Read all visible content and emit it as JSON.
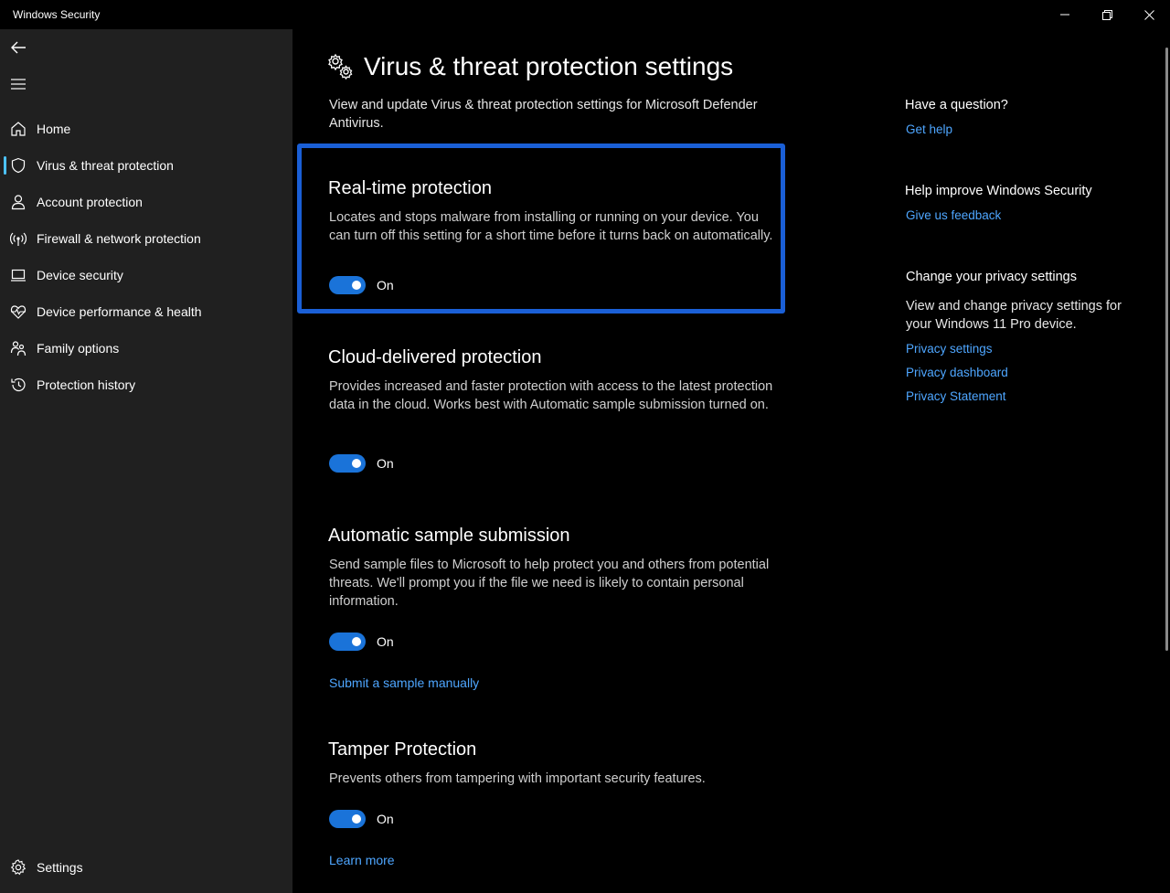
{
  "window": {
    "title": "Windows Security"
  },
  "sidebar": {
    "items": [
      {
        "label": "Home",
        "icon": "home-icon"
      },
      {
        "label": "Virus & threat protection",
        "icon": "shield-icon",
        "active": true
      },
      {
        "label": "Account protection",
        "icon": "person-icon"
      },
      {
        "label": "Firewall & network protection",
        "icon": "wifi-broadcast-icon"
      },
      {
        "label": "Device security",
        "icon": "laptop-icon"
      },
      {
        "label": "Device performance & health",
        "icon": "heart-pulse-icon"
      },
      {
        "label": "Family options",
        "icon": "family-icon"
      },
      {
        "label": "Protection history",
        "icon": "history-icon"
      }
    ],
    "settings_label": "Settings"
  },
  "main": {
    "title": "Virus & threat protection settings",
    "description": "View and update Virus & threat protection settings for Microsoft Defender Antivirus.",
    "sections": [
      {
        "title": "Real-time protection",
        "description": "Locates and stops malware from installing or running on your device. You can turn off this setting for a short time before it turns back on automatically.",
        "toggle_state": "On"
      },
      {
        "title": "Cloud-delivered protection",
        "description": "Provides increased and faster protection with access to the latest protection data in the cloud. Works best with Automatic sample submission turned on.",
        "toggle_state": "On"
      },
      {
        "title": "Automatic sample submission",
        "description": "Send sample files to Microsoft to help protect you and others from potential threats. We'll prompt you if the file we need is likely to contain personal information.",
        "toggle_state": "On",
        "link": "Submit a sample manually"
      },
      {
        "title": "Tamper Protection",
        "description": "Prevents others from tampering with important security features.",
        "toggle_state": "On",
        "link": "Learn more"
      }
    ]
  },
  "aside": {
    "question_heading": "Have a question?",
    "get_help": "Get help",
    "improve_heading": "Help improve Windows Security",
    "feedback": "Give us feedback",
    "privacy_heading": "Change your privacy settings",
    "privacy_text": "View and change privacy settings for your Windows 11 Pro device.",
    "privacy_settings": "Privacy settings",
    "privacy_dashboard": "Privacy dashboard",
    "privacy_statement": "Privacy Statement"
  },
  "colors": {
    "accent": "#1a73d9",
    "link": "#4ea6ff",
    "highlight_border": "#1a5fd6",
    "sidebar_bg": "#202020"
  }
}
